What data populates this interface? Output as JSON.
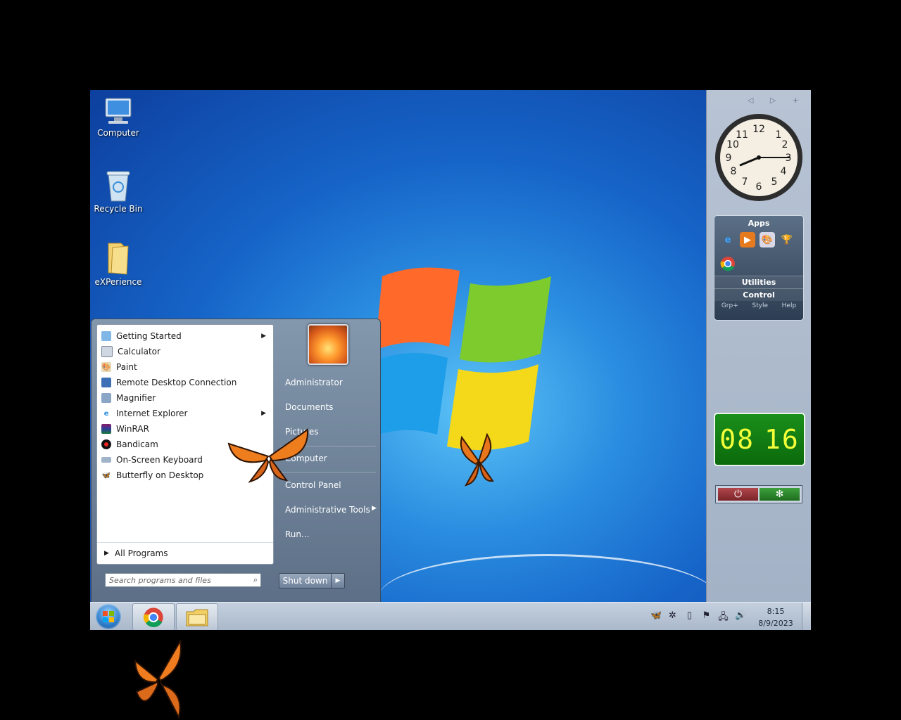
{
  "desktop_icons": [
    {
      "label": "Computer",
      "icon": "computer-icon"
    },
    {
      "label": "Recycle Bin",
      "icon": "recycle-bin-icon"
    },
    {
      "label": "eXPerience",
      "icon": "folder-icon"
    }
  ],
  "start_menu": {
    "programs": [
      {
        "label": "Getting Started",
        "icon": "getting-started-icon",
        "submenu": true
      },
      {
        "label": "Calculator",
        "icon": "calculator-icon",
        "submenu": false
      },
      {
        "label": "Paint",
        "icon": "paint-icon",
        "submenu": false
      },
      {
        "label": "Remote Desktop Connection",
        "icon": "remote-desktop-icon",
        "submenu": false
      },
      {
        "label": "Magnifier",
        "icon": "magnifier-icon",
        "submenu": false
      },
      {
        "label": "Internet Explorer",
        "icon": "internet-explorer-icon",
        "submenu": true
      },
      {
        "label": "WinRAR",
        "icon": "winrar-icon",
        "submenu": false
      },
      {
        "label": "Bandicam",
        "icon": "bandicam-icon",
        "submenu": false
      },
      {
        "label": "On-Screen Keyboard",
        "icon": "keyboard-icon",
        "submenu": false
      },
      {
        "label": "Butterfly on Desktop",
        "icon": "butterfly-icon",
        "submenu": false
      }
    ],
    "all_programs": "All Programs",
    "search_placeholder": "Search programs and files",
    "right_items": [
      {
        "label": "Administrator"
      },
      {
        "label": "Documents"
      },
      {
        "label": "Pictures"
      },
      {
        "label": "Computer"
      },
      {
        "label": "Control Panel"
      },
      {
        "label": "Administrative Tools",
        "submenu": true
      },
      {
        "label": "Run..."
      }
    ],
    "shutdown_label": "Shut down"
  },
  "gadgets": {
    "clock": {
      "hour": 8,
      "minute": 15
    },
    "apps": {
      "title": "Apps",
      "items": [
        "internet-explorer-icon",
        "media-player-icon",
        "paint-icon",
        "trophy-icon",
        "chrome-icon"
      ],
      "utilities": "Utilities",
      "control": "Control",
      "footer": [
        "Grp+",
        "Style",
        "Help"
      ]
    },
    "digital_clock": {
      "hours": "08",
      "minutes": "16"
    }
  },
  "taskbar": {
    "pinned": [
      "chrome-icon",
      "file-explorer-icon"
    ],
    "tray_icons": [
      "butterfly-icon",
      "network-tool-icon",
      "document-icon",
      "flag-icon",
      "network-icon",
      "volume-icon"
    ],
    "time": "8:15",
    "date": "8/9/2023"
  },
  "colors": {
    "desktop_blue": "#1664c8",
    "taskbar": "#b5c3d4",
    "digital_clock_bg": "#0f7a0f",
    "digital_clock_text": "#f4ff3a"
  }
}
